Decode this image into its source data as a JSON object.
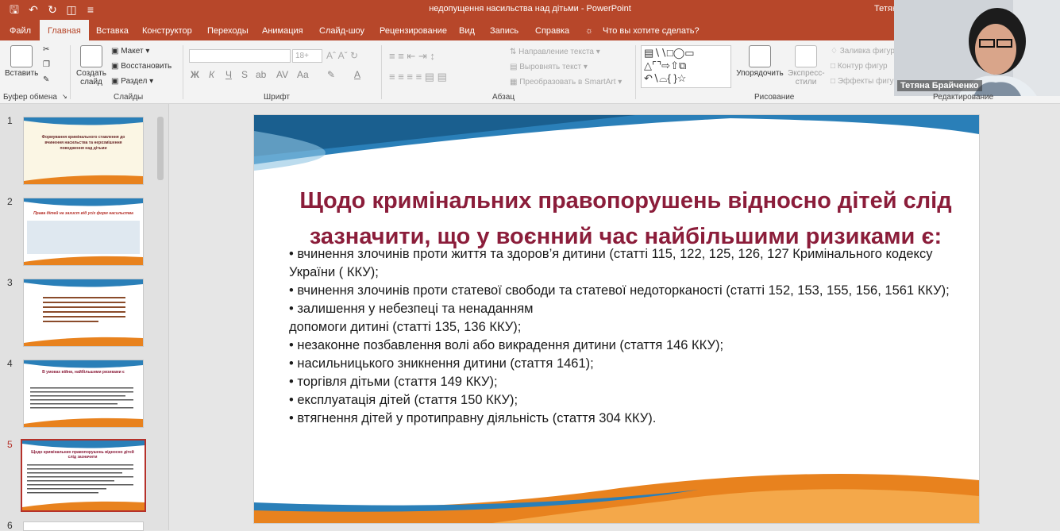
{
  "app": {
    "document_title": "недопущення насильства над дітьми  -  PowerPoint",
    "user_name": "Тетяна Брай"
  },
  "menu": {
    "tabs": [
      "Файл",
      "Главная",
      "Вставка",
      "Конструктор",
      "Переходы",
      "Анимация",
      "Слайд-шоу",
      "Рецензирование",
      "Вид",
      "Запись",
      "Справка"
    ],
    "search": "Что вы хотите сделать?"
  },
  "ribbon": {
    "clipboard": {
      "paste": "Вставить",
      "group": "Буфер обмена"
    },
    "slides": {
      "new_slide": "Создать слайд",
      "layout": "Макет",
      "reset": "Восстановить",
      "section": "Раздел",
      "group": "Слайды"
    },
    "font": {
      "size": "18+",
      "group": "Шрифт"
    },
    "paragraph": {
      "text_direction": "Направление текста",
      "align_text": "Выровнять текст",
      "smartart": "Преобразовать в SmartArt",
      "group": "Абзац"
    },
    "drawing": {
      "arrange": "Упорядочить",
      "quick_styles": "Экспресс-стили",
      "fill": "Заливка фигур",
      "outline": "Контур фигур",
      "effects": "Эффекты фигур",
      "group": "Рисование"
    },
    "editing": {
      "group": "Редактирование"
    }
  },
  "video": {
    "name": "Тетяна Брайченко"
  },
  "thumbnails": [
    {
      "num": "1",
      "title": "Формування кримінального ставлення до вчинення насильства та нерозмішення поводження над дітьми"
    },
    {
      "num": "2",
      "title": "Права дітей на захист від усіх форм насильства"
    },
    {
      "num": "3",
      "title": ""
    },
    {
      "num": "4",
      "title": "В умовах війни, найбільшими ризиками є"
    },
    {
      "num": "5",
      "title": "Щодо кримінальних правопорушень відносно дітей слід зазначити"
    },
    {
      "num": "6",
      "title": ""
    }
  ],
  "slide": {
    "title_line1": "Щодо кримінальних правопорушень відносно дітей слід",
    "title_line2": "зазначити, що у воєнний час найбільшими ризиками є:",
    "bullets": [
      "• вчинення злочинів проти життя та здоров’я дитини (статті 115, 122, 125, 126, 127 Кримінального кодексу України ( ККУ);",
      "• вчинення злочинів проти статевої свободи та статевої недоторканості (статті 152, 153, 155, 156, 1561 ККУ);",
      "• залишення у небезпеці та ненаданням допомоги дитині (статті 135, 136 ККУ);",
      "• незаконне позбавлення волі або викрадення дитини (стаття 146 ККУ);",
      "• насильницького зникнення дитини (стаття 1461);",
      "• торгівля дітьми (стаття 149 ККУ);",
      "• експлуатація дітей (стаття 150 ККУ);",
      "• втягнення дітей у протиправну діяльність (стаття 304 ККУ)."
    ]
  },
  "colors": {
    "accent": "#b7472a",
    "title": "#8b1d3a",
    "swoosh_blue": "#2a7fb8",
    "swoosh_orange": "#e8821e"
  }
}
